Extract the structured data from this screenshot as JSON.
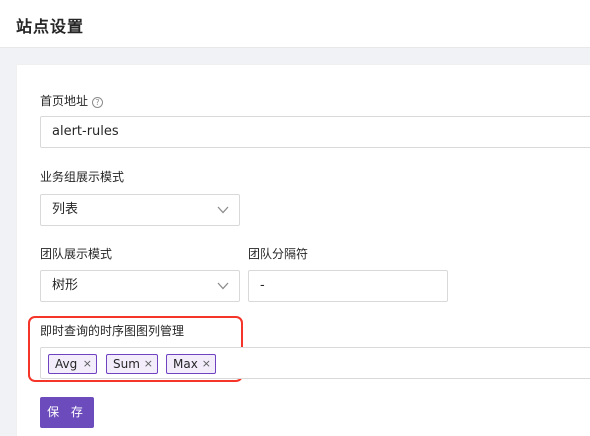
{
  "page": {
    "title": "站点设置"
  },
  "form": {
    "home_url": {
      "label": "首页地址",
      "help_icon": "question-circle-icon",
      "value": "alert-rules"
    },
    "group_display": {
      "label": "业务组展示模式",
      "value": "列表",
      "icon": "chevron-down-icon"
    },
    "team_display": {
      "label": "团队展示模式",
      "value": "树形",
      "icon": "chevron-down-icon"
    },
    "team_separator": {
      "label": "团队分隔符",
      "value": "-"
    },
    "instant_query_series": {
      "label": "即时查询的时序图图列管理",
      "tags": [
        "Avg",
        "Sum",
        "Max"
      ],
      "tag_close_glyph": "×"
    },
    "save_label": "保 存"
  },
  "colors": {
    "accent": "#6c4bbd",
    "highlight_border": "#f5342a",
    "tag_bg": "#f2ecfb"
  }
}
